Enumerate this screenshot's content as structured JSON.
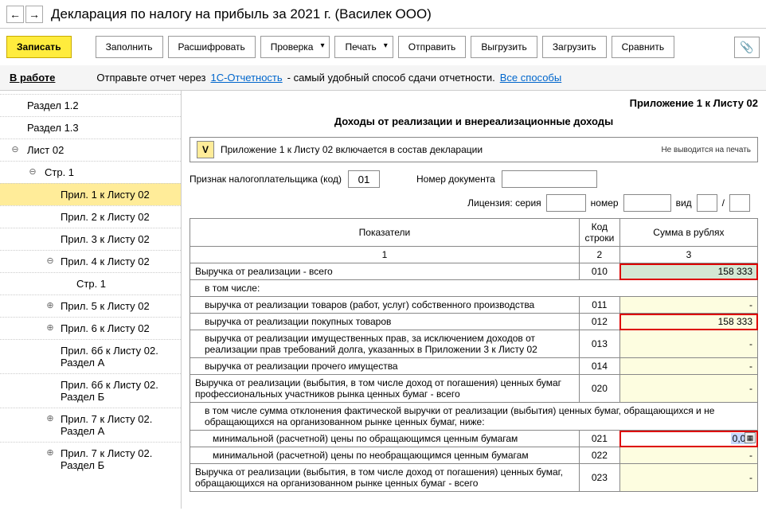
{
  "nav": {
    "back": "←",
    "fwd": "→"
  },
  "title": "Декларация по налогу на прибыль за 2021 г. (Василек ООО)",
  "toolbar": {
    "save": "Записать",
    "fill": "Заполнить",
    "decode": "Расшифровать",
    "check": "Проверка",
    "print": "Печать",
    "send": "Отправить",
    "export": "Выгрузить",
    "import": "Загрузить",
    "compare": "Сравнить"
  },
  "infobar": {
    "status": "В работе",
    "text1": "Отправьте отчет через",
    "link1": "1С-Отчетность",
    "text2": "- самый удобный способ сдачи отчетности.",
    "link2": "Все способы"
  },
  "tree": [
    {
      "label": "Раздел 1.2",
      "lvl": 1,
      "tg": ""
    },
    {
      "label": "Раздел 1.3",
      "lvl": 1,
      "tg": ""
    },
    {
      "label": "Лист 02",
      "lvl": 1,
      "tg": "⊖"
    },
    {
      "label": "Стр. 1",
      "lvl": 2,
      "tg": "⊖"
    },
    {
      "label": "Прил. 1 к Листу 02",
      "lvl": 3,
      "tg": "",
      "sel": true
    },
    {
      "label": "Прил. 2 к Листу 02",
      "lvl": 3,
      "tg": ""
    },
    {
      "label": "Прил. 3 к Листу 02",
      "lvl": 3,
      "tg": ""
    },
    {
      "label": "Прил. 4 к Листу 02",
      "lvl": 3,
      "tg": "⊖"
    },
    {
      "label": "Стр. 1",
      "lvl": 4,
      "tg": ""
    },
    {
      "label": "Прил. 5 к Листу 02",
      "lvl": 3,
      "tg": "⊕"
    },
    {
      "label": "Прил. 6 к Листу 02",
      "lvl": 3,
      "tg": "⊕"
    },
    {
      "label": "Прил. 6б к Листу 02. Раздел А",
      "lvl": 3,
      "tg": ""
    },
    {
      "label": "Прил. 6б к Листу 02. Раздел Б",
      "lvl": 3,
      "tg": ""
    },
    {
      "label": "Прил. 7 к Листу 02. Раздел А",
      "lvl": 3,
      "tg": "⊕"
    },
    {
      "label": "Прил. 7 к Листу 02. Раздел Б",
      "lvl": 3,
      "tg": "⊕"
    }
  ],
  "header": {
    "appendix": "Приложение 1 к Листу 02",
    "subtitle": "Доходы от реализации и внереализационные доходы"
  },
  "chk": {
    "mark": "V",
    "label": "Приложение 1 к Листу 02 включается в состав декларации",
    "note": "Не выводится на печать"
  },
  "form": {
    "taxpayer_label": "Признак налогоплательщика (код)",
    "taxpayer_code": "01",
    "docnum_label": "Номер документа",
    "license_label": "Лицензия: серия",
    "number_label": "номер",
    "type_label": "вид",
    "slash": "/"
  },
  "cols": {
    "ind": "Показатели",
    "code": "Код строки",
    "sum": "Сумма в рублях",
    "n1": "1",
    "n2": "2",
    "n3": "3"
  },
  "rows": [
    {
      "ind": "Выручка от реализации - всего",
      "code": "010",
      "sum": "158 333",
      "cls": "green red",
      "i": 0
    },
    {
      "ind": "в том числе:",
      "code": "",
      "sum": "",
      "cls": "",
      "i": 1
    },
    {
      "ind": "выручка от реализации товаров (работ, услуг) собственного производства",
      "code": "011",
      "sum": "-",
      "cls": "yellow",
      "i": 1
    },
    {
      "ind": "выручка от реализации покупных товаров",
      "code": "012",
      "sum": "158 333",
      "cls": "yellow red",
      "i": 1
    },
    {
      "ind": "выручка от реализации имущественных прав, за исключением доходов от реализации прав требований долга, указанных в Приложении 3 к Листу 02",
      "code": "013",
      "sum": "-",
      "cls": "yellow",
      "i": 1
    },
    {
      "ind": "выручка от реализации прочего имущества",
      "code": "014",
      "sum": "-",
      "cls": "yellow",
      "i": 1
    },
    {
      "ind": "Выручка от реализации (выбытия, в том числе доход от погашения) ценных бумаг профессиональных участников рынка ценных бумаг - всего",
      "code": "020",
      "sum": "-",
      "cls": "yellow",
      "i": 0
    },
    {
      "ind": "в том числе сумма отклонения фактической выручки от реализации (выбытия) ценных бумаг, обращающихся и не обращающихся на организованном рынке ценных бумаг, ниже:",
      "code": "",
      "sum": "",
      "cls": "",
      "i": 1
    },
    {
      "ind": "минимальной (расчетной) цены по обращающимся ценным бумагам",
      "code": "021",
      "sum": "0,00",
      "cls": "white red edit",
      "i": 2
    },
    {
      "ind": "минимальной (расчетной) цены по необращающимся ценным бумагам",
      "code": "022",
      "sum": "-",
      "cls": "yellow",
      "i": 2
    },
    {
      "ind": "Выручка от реализации (выбытия, в том числе доход от погашения) ценных бумаг, обращающихся на организованном рынке ценных бумаг - всего",
      "code": "023",
      "sum": "-",
      "cls": "yellow",
      "i": 0
    }
  ]
}
